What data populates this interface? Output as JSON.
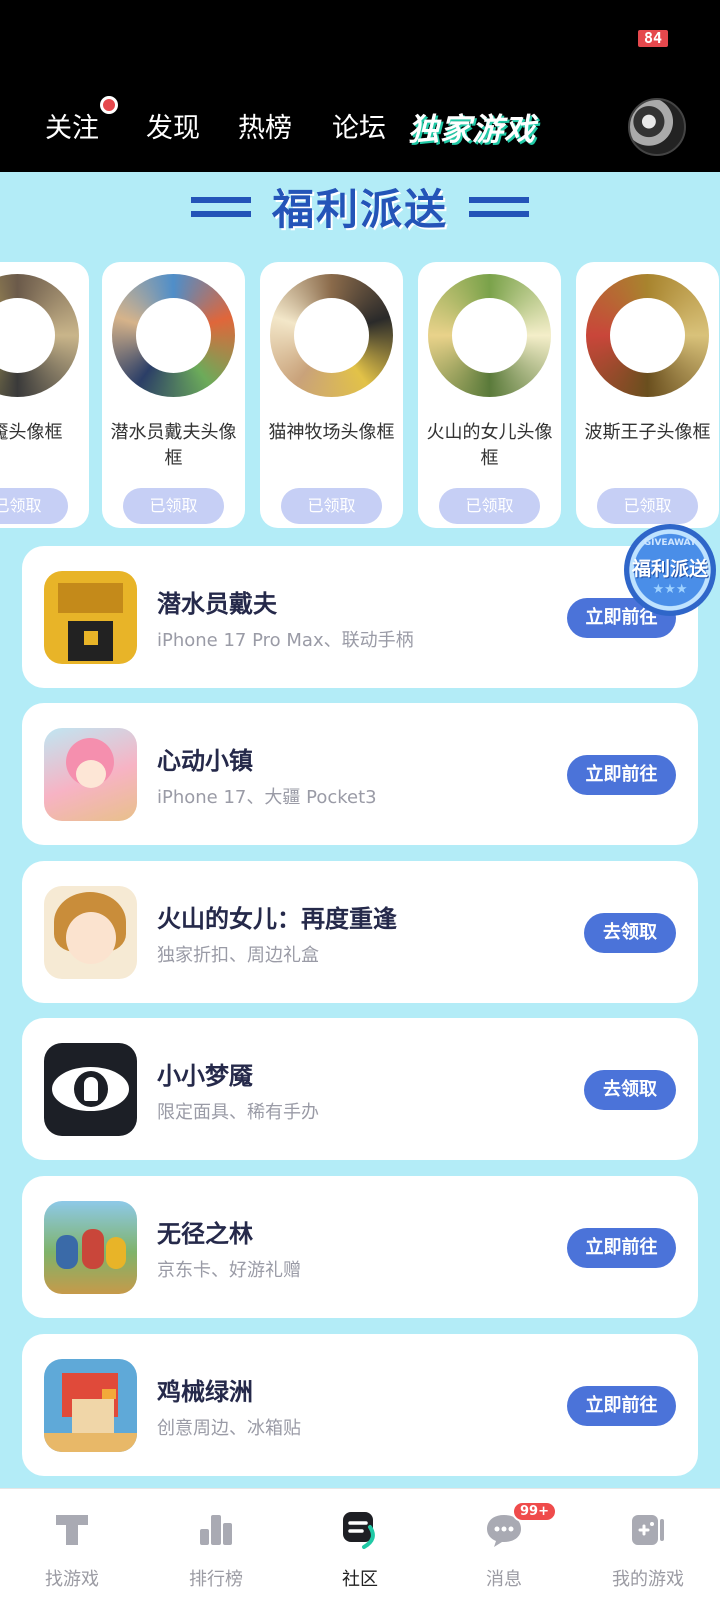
{
  "status_bar": {
    "battery": "84"
  },
  "header": {
    "tabs": [
      {
        "label": "关注",
        "has_dot": true
      },
      {
        "label": "发现"
      },
      {
        "label": "热榜"
      },
      {
        "label": "论坛"
      }
    ],
    "exclusive_label": "独家游戏"
  },
  "banner": {
    "title": "福利派送"
  },
  "frames": [
    {
      "name": "梦魇头像框",
      "button": "已领取",
      "color": "#6b5a4a"
    },
    {
      "name": "潜水员戴夫头像框",
      "button": "已领取",
      "color": "#4f8ec9"
    },
    {
      "name": "猫神牧场头像框",
      "button": "已领取",
      "color": "#8a6a4a"
    },
    {
      "name": "火山的女儿头像框",
      "button": "已领取",
      "color": "#7aa24a"
    },
    {
      "name": "波斯王子头像框",
      "button": "已领取",
      "color": "#a8842e"
    }
  ],
  "giveaway_badge": {
    "small": "GIVEAWAY",
    "main": "福利派送",
    "stars": "★★★"
  },
  "games": [
    {
      "title": "潜水员戴夫",
      "subtitle": "iPhone 17 Pro Max、联动手柄",
      "action": "立即前往",
      "icon_bg": "#e8b428"
    },
    {
      "title": "心动小镇",
      "subtitle": "iPhone 17、大疆 Pocket3",
      "action": "立即前往",
      "icon_bg": "#f7b3c4"
    },
    {
      "title": "火山的女儿：再度重逢",
      "subtitle": "独家折扣、周边礼盒",
      "action": "去领取",
      "icon_bg": "#f3d9b0"
    },
    {
      "title": "小小梦魇",
      "subtitle": "限定面具、稀有手办",
      "action": "去领取",
      "icon_bg": "#1c1f26"
    },
    {
      "title": "无径之林",
      "subtitle": "京东卡、好游礼赠",
      "action": "立即前往",
      "icon_bg": "#7cb7d6"
    },
    {
      "title": "鸡械绿洲",
      "subtitle": "创意周边、冰箱贴",
      "action": "立即前往",
      "icon_bg": "#5fa9d8"
    }
  ],
  "bottom_nav": {
    "items": [
      {
        "label": "找游戏",
        "icon": "find-game-icon"
      },
      {
        "label": "排行榜",
        "icon": "ranking-icon"
      },
      {
        "label": "社区",
        "icon": "community-icon",
        "active": true
      },
      {
        "label": "消息",
        "icon": "message-icon",
        "badge": "99+"
      },
      {
        "label": "我的游戏",
        "icon": "my-games-icon"
      }
    ]
  }
}
